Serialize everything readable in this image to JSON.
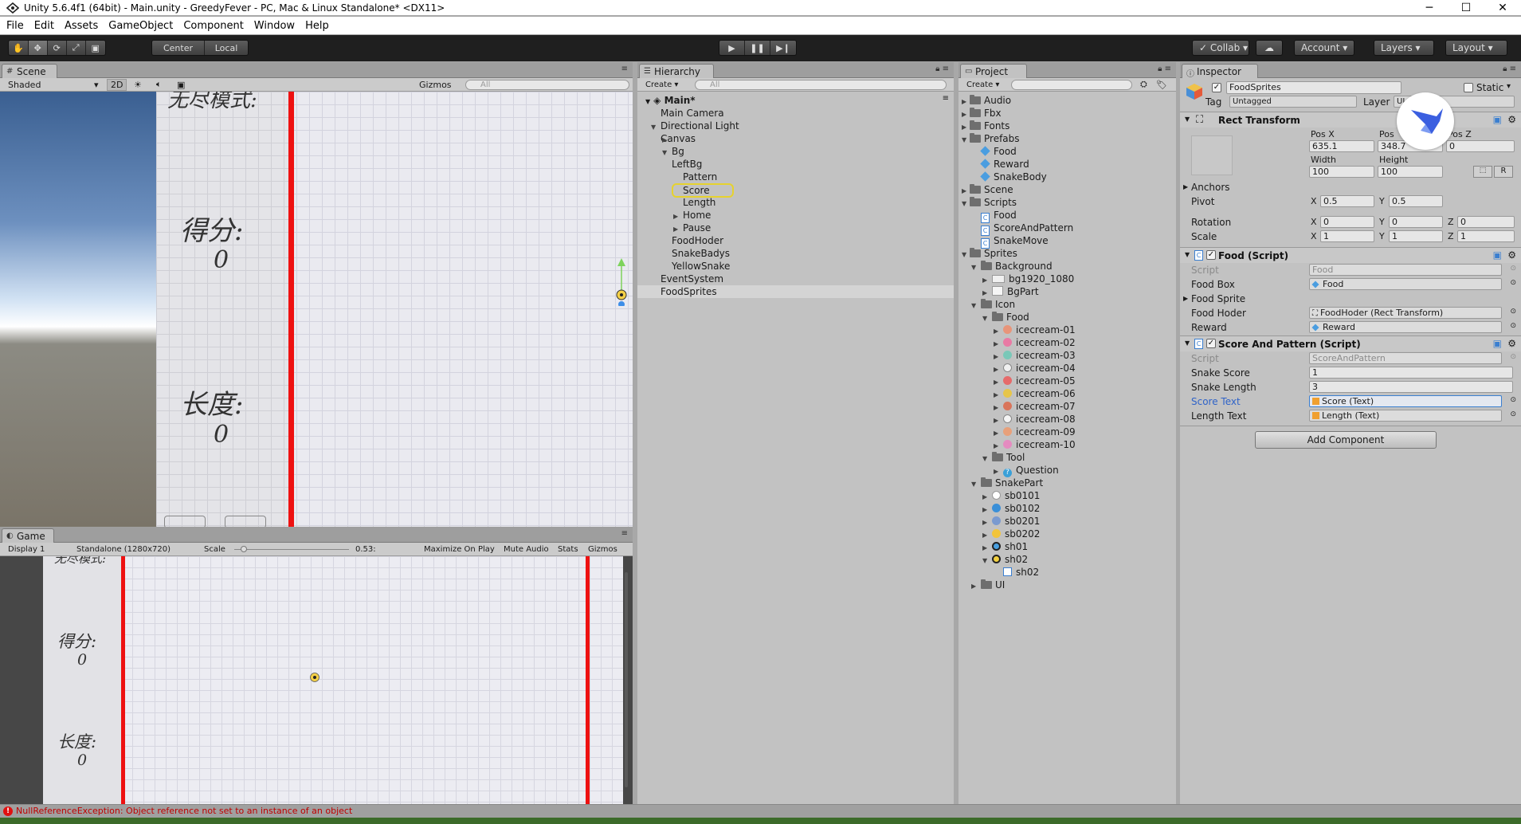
{
  "window": {
    "title": "Unity 5.6.4f1 (64bit) - Main.unity - GreedyFever - PC, Mac & Linux Standalone* <DX11>",
    "minimize": "─",
    "maximize": "☐",
    "close": "✕"
  },
  "menu": [
    "File",
    "Edit",
    "Assets",
    "GameObject",
    "Component",
    "Window",
    "Help"
  ],
  "toolbar": {
    "pivot": "Center",
    "space": "Local",
    "collab": "Collab",
    "account": "Account",
    "layers": "Layers",
    "layout": "Layout"
  },
  "scene": {
    "tab": "Scene",
    "shading": "Shaded",
    "mode2d": "2D",
    "gizmos": "Gizmos",
    "search": "All",
    "top_label": "无尽模式:",
    "score_label": "得分:",
    "score_value": "0",
    "length_label": "长度:",
    "length_value": "0"
  },
  "game": {
    "tab": "Game",
    "display": "Display 1",
    "resolution": "Standalone (1280x720)",
    "scale_label": "Scale",
    "scale_value": "0.53:",
    "maximize": "Maximize On Play",
    "mute": "Mute Audio",
    "stats": "Stats",
    "gizmos": "Gizmos",
    "top_label": "无尽模式:",
    "score_label": "得分:",
    "score_value": "0",
    "length_label": "长度:",
    "length_value": "0"
  },
  "hierarchy": {
    "tab": "Hierarchy",
    "create": "Create",
    "search": "All",
    "scene_name": "Main*",
    "items": [
      {
        "label": "Main Camera"
      },
      {
        "label": "Directional Light"
      },
      {
        "label": "Canvas"
      },
      {
        "label": "Bg"
      },
      {
        "label": "LeftBg"
      },
      {
        "label": "Pattern"
      },
      {
        "label": "Score"
      },
      {
        "label": "Length"
      },
      {
        "label": "Home"
      },
      {
        "label": "Pause"
      },
      {
        "label": "FoodHoder"
      },
      {
        "label": "SnakeBadys"
      },
      {
        "label": "YellowSnake"
      },
      {
        "label": "EventSystem"
      },
      {
        "label": "FoodSprites"
      }
    ]
  },
  "project": {
    "tab": "Project",
    "create": "Create",
    "items": [
      {
        "label": "Audio"
      },
      {
        "label": "Fbx"
      },
      {
        "label": "Fonts"
      },
      {
        "label": "Prefabs"
      },
      {
        "label": "Food"
      },
      {
        "label": "Reward"
      },
      {
        "label": "SnakeBody"
      },
      {
        "label": "Scene"
      },
      {
        "label": "Scripts"
      },
      {
        "label": "Food"
      },
      {
        "label": "ScoreAndPattern"
      },
      {
        "label": "SnakeMove"
      },
      {
        "label": "Sprites"
      },
      {
        "label": "Background"
      },
      {
        "label": "bg1920_1080"
      },
      {
        "label": "BgPart"
      },
      {
        "label": "Icon"
      },
      {
        "label": "Food"
      },
      {
        "label": "icecream-01"
      },
      {
        "label": "icecream-02"
      },
      {
        "label": "icecream-03"
      },
      {
        "label": "icecream-04"
      },
      {
        "label": "icecream-05"
      },
      {
        "label": "icecream-06"
      },
      {
        "label": "icecream-07"
      },
      {
        "label": "icecream-08"
      },
      {
        "label": "icecream-09"
      },
      {
        "label": "icecream-10"
      },
      {
        "label": "Tool"
      },
      {
        "label": "Question"
      },
      {
        "label": "SnakePart"
      },
      {
        "label": "sb0101"
      },
      {
        "label": "sb0102"
      },
      {
        "label": "sb0201"
      },
      {
        "label": "sb0202"
      },
      {
        "label": "sh01"
      },
      {
        "label": "sh02"
      },
      {
        "label": "sh02"
      },
      {
        "label": "UI"
      }
    ]
  },
  "inspector": {
    "tab": "Inspector",
    "object_name": "FoodSprites",
    "static_label": "Static",
    "tag_label": "Tag",
    "tag_value": "Untagged",
    "layer_label": "Layer",
    "layer_value": "UI",
    "rect_transform": {
      "title": "Rect Transform",
      "posx_label": "Pos X",
      "posy_label": "Pos",
      "posz_label": "Pos Z",
      "posx": "635.1",
      "posy": "348.7",
      "posz": "0",
      "width_label": "Width",
      "height_label": "Height",
      "width": "100",
      "height": "100",
      "r_btn": "R",
      "anchors": "Anchors",
      "pivot": "Pivot",
      "pivot_x": "0.5",
      "pivot_y": "0.5",
      "rotation": "Rotation",
      "rot_x": "0",
      "rot_y": "0",
      "rot_z": "0",
      "scale": "Scale",
      "scale_x": "1",
      "scale_y": "1",
      "scale_z": "1",
      "x": "X",
      "y": "Y",
      "z": "Z"
    },
    "food_script": {
      "title": "Food (Script)",
      "script_label": "Script",
      "script_value": "Food",
      "foodbox_label": "Food Box",
      "foodbox_value": "Food",
      "foodsprite_label": "Food Sprite",
      "foodhoder_label": "Food Hoder",
      "foodhoder_value": "FoodHoder (Rect Transform)",
      "reward_label": "Reward",
      "reward_value": "Reward"
    },
    "score_script": {
      "title": "Score And Pattern (Script)",
      "script_label": "Script",
      "script_value": "ScoreAndPattern",
      "snakescore_label": "Snake Score",
      "snakescore_value": "1",
      "snakelength_label": "Snake Length",
      "snakelength_value": "3",
      "scoretext_label": "Score Text",
      "scoretext_value": "Score (Text)",
      "lengthtext_label": "Length Text",
      "lengthtext_value": "Length (Text)"
    },
    "add_component": "Add Component"
  },
  "status": {
    "error": "NullReferenceException: Object reference not set to an instance of an object"
  },
  "colors": {
    "accent": "#3b7fd0",
    "red_border": "#ee1111",
    "error": "#c00000"
  }
}
